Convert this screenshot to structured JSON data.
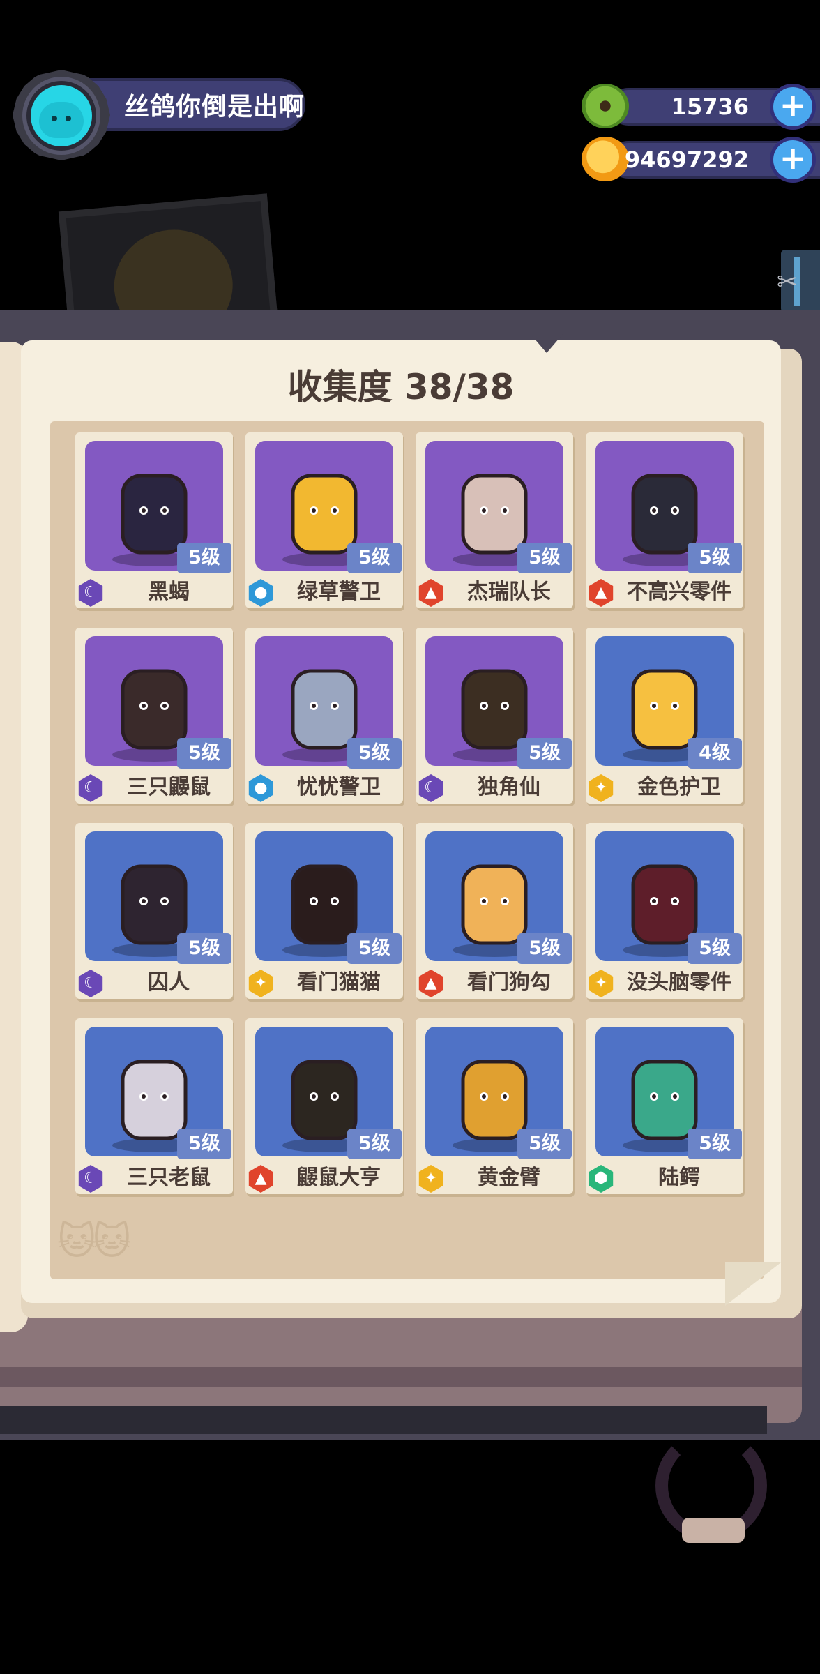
{
  "profile": {
    "name": "丝鸽你倒是出啊",
    "avatar": "cyan-cat-avatar"
  },
  "currencies": [
    {
      "name": "donut-currency",
      "value": "15736",
      "color": "#7dbb3b"
    },
    {
      "name": "planet-coin-currency",
      "value": "94697292",
      "color": "#f5b01e"
    }
  ],
  "collection": {
    "title": "收集度 38/38"
  },
  "colors": {
    "purple_card": "#8359c2",
    "blue_card": "#4f72c6",
    "rarity_purple": "#6a48b6",
    "rarity_blue": "#2e98d8",
    "rarity_red": "#e0442c",
    "rarity_gold": "#f0b21e",
    "rarity_green": "#29b67a"
  },
  "cards": [
    {
      "name": "黑蝎",
      "level": "5级",
      "bg": "purple",
      "rarity": "purple",
      "icon": "scorpion-icon"
    },
    {
      "name": "绿草警卫",
      "level": "5级",
      "bg": "purple",
      "rarity": "blue",
      "icon": "grass-guard-icon"
    },
    {
      "name": "杰瑞队长",
      "level": "5级",
      "bg": "purple",
      "rarity": "red",
      "icon": "cat-captain-icon"
    },
    {
      "name": "不高兴零件",
      "level": "5级",
      "bg": "purple",
      "rarity": "red",
      "icon": "grumpy-part-icon"
    },
    {
      "name": "三只鼹鼠",
      "level": "5级",
      "bg": "purple",
      "rarity": "purple",
      "icon": "three-moles-icon"
    },
    {
      "name": "忧忧警卫",
      "level": "5级",
      "bg": "purple",
      "rarity": "blue",
      "icon": "sad-guard-icon"
    },
    {
      "name": "独角仙",
      "level": "5级",
      "bg": "purple",
      "rarity": "purple",
      "icon": "beetle-icon"
    },
    {
      "name": "金色护卫",
      "level": "4级",
      "bg": "blue",
      "rarity": "gold",
      "icon": "golden-guard-icon"
    },
    {
      "name": "囚人",
      "level": "5级",
      "bg": "blue",
      "rarity": "purple",
      "icon": "prisoner-icon"
    },
    {
      "name": "看门猫猫",
      "level": "5级",
      "bg": "blue",
      "rarity": "gold",
      "icon": "gate-cat-icon"
    },
    {
      "name": "看门狗勾",
      "level": "5级",
      "bg": "blue",
      "rarity": "red",
      "icon": "gate-dog-icon"
    },
    {
      "name": "没头脑零件",
      "level": "5级",
      "bg": "blue",
      "rarity": "gold",
      "icon": "brainless-part-icon"
    },
    {
      "name": "三只老鼠",
      "level": "5级",
      "bg": "blue",
      "rarity": "purple",
      "icon": "three-mice-icon"
    },
    {
      "name": "鼹鼠大亨",
      "level": "5级",
      "bg": "blue",
      "rarity": "red",
      "icon": "mole-tycoon-icon"
    },
    {
      "name": "黄金臂",
      "level": "5级",
      "bg": "blue",
      "rarity": "gold",
      "icon": "golden-arm-icon"
    },
    {
      "name": "陆鳄",
      "level": "5级",
      "bg": "blue",
      "rarity": "green",
      "icon": "land-croc-icon"
    }
  ]
}
